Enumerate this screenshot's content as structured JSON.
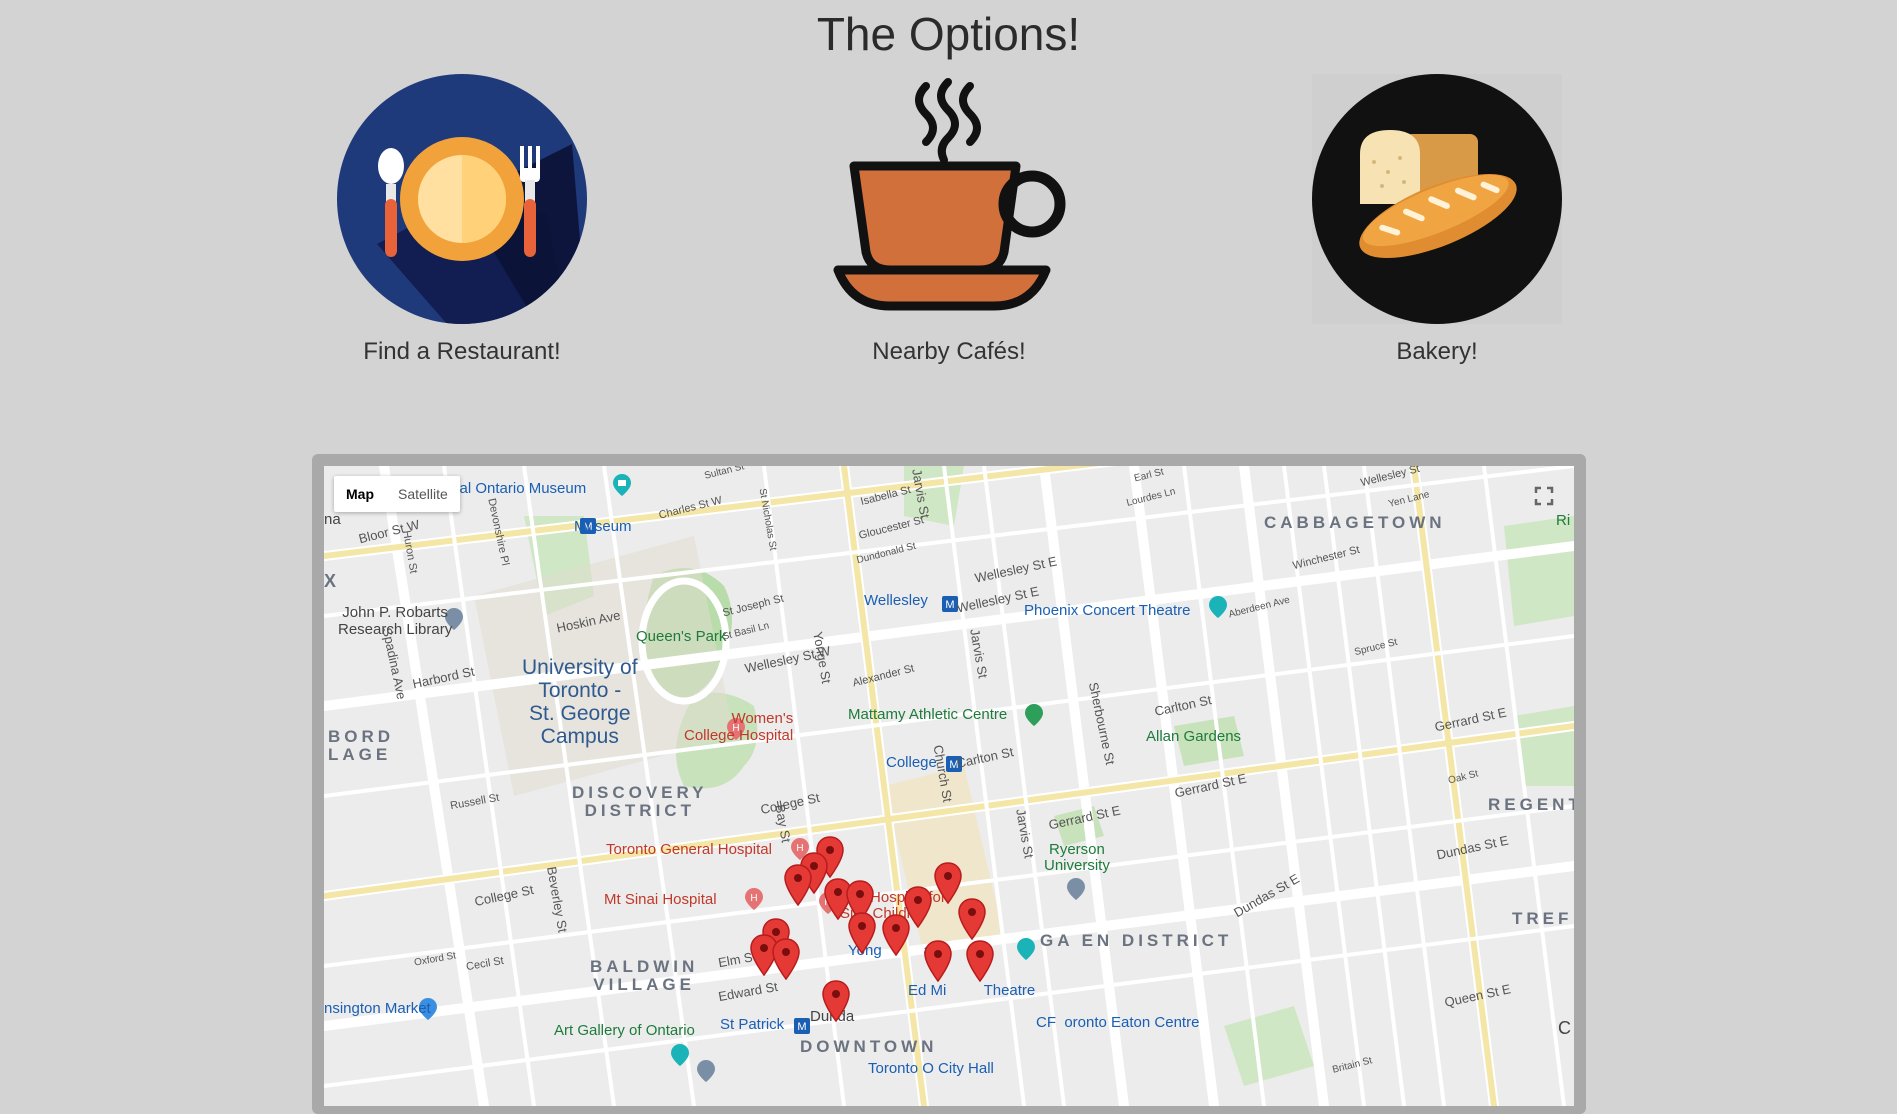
{
  "page": {
    "title": "The Options!"
  },
  "options": [
    {
      "label": "Find a Restaurant!",
      "icon": "plate-with-cutlery-icon"
    },
    {
      "label": "Nearby Cafés!",
      "icon": "coffee-cup-icon"
    },
    {
      "label": "Bakery!",
      "icon": "bread-icon"
    }
  ],
  "map": {
    "type_controls": {
      "map": "Map",
      "satellite": "Satellite",
      "selected": "Map"
    },
    "fullscreen_icon": "fullscreen-icon",
    "places": {
      "royal_ontario_museum": "yal Ontario Museum",
      "museum_station": "Museum",
      "robarts": "John P. Robarts\nResearch Library",
      "queens_park": "Queen's Park",
      "university": "University of\nToronto -\nSt. George\nCampus",
      "womens_college": "Women's\nCollege Hospital",
      "discovery_district": "DISCOVERY\nDISTRICT",
      "toronto_general": "Toronto General Hospital",
      "mt_sinai": "Mt Sinai Hospital",
      "sick_children": "The Hospital for\nSick Childre",
      "baldwin_village": "BALDWIN\nVILLAGE",
      "art_gallery": "Art Gallery of Ontario",
      "st_patrick": "St Patrick",
      "downtown": "DOWNTOWN",
      "city_hall": "Toronto O  City Hall",
      "kensington": "nsington Market",
      "wellesley_station": "Wellesley",
      "phoenix": "Phoenix Concert Theatre",
      "mattamy": "Mattamy Athletic Centre",
      "college_station": "College",
      "allan_gardens": "Allan Gardens",
      "ryerson": "Ryerson\nUniversity",
      "garden_district": "GA    EN DISTRICT",
      "ed_mirvish": "Ed Mi         Theatre",
      "eaton_centre": "CF  oronto Eaton Centre",
      "yonge_square": "Yong          are",
      "cabbagetown": "CABBAGETOWN",
      "regent": "REGENT",
      "tref": "TREF",
      "bord_lage": "BORD\nLAGE",
      "na": "na",
      "x": "X",
      "ri": "Ri",
      "c": "C",
      "dunda": "Dunda"
    },
    "streets": {
      "bloor": "Bloor St W",
      "hoskin": "Hoskin Ave",
      "harbord": "Harbord St",
      "wellesley_w": "Wellesley St W",
      "wellesley_e1": "Wellesley St E",
      "wellesley_e2": "Wellesley St E",
      "college": "College St",
      "college2": "College St",
      "carlton": "Carlton St",
      "carlton2": "Carlton St",
      "gerrard": "Gerrard St E",
      "gerrard2": "Gerrard St E",
      "gerrard3": "Gerrard St E",
      "dundas": "Dundas St E",
      "dundas2": "Dundas St E",
      "queen": "Queen St E",
      "spadina": "Spadina Ave",
      "yonge": "Yonge St",
      "bay": "Bay St",
      "church": "Church St",
      "jarvis": "Jarvis St",
      "jarvis2": "Jarvis St",
      "jarvis3": "Jarvis St",
      "sherbourne": "Sherbourne St",
      "elm": "Elm St",
      "edward": "Edward St",
      "beverley": "Beverley St",
      "russell": "Russell St",
      "cecil": "Cecil St",
      "oxford": "Oxford St",
      "huron": "Huron St",
      "devonshire": "Devonshire Pl",
      "charles": "Charles St W",
      "st_joseph": "St Joseph St",
      "st_basil": "St Basil Ln",
      "isabella": "Isabella St",
      "gloucester": "Gloucester St",
      "dundonald": "Dundonald St",
      "alexander": "Alexander St",
      "st_nicholas": "St Nicholas St",
      "winchester": "Winchester St",
      "spruce": "Spruce St",
      "aberdeen": "Aberdeen Ave",
      "earl": "Earl St",
      "lourdes": "Lourdes Ln",
      "yen": "Yen Lane",
      "wellesley_top": "Wellesley St",
      "oak": "Oak St",
      "britain": "Britain St",
      "sultan": "Sultan St"
    },
    "marker_color": "#e53935",
    "marker_count": 16
  },
  "colors": {
    "background": "#d3d3d3",
    "map_frame": "#a9a9a9",
    "restaurant_circle": "#1f3a7a",
    "bakery_circle": "#111111",
    "coffee_cup": "#d2703b"
  }
}
